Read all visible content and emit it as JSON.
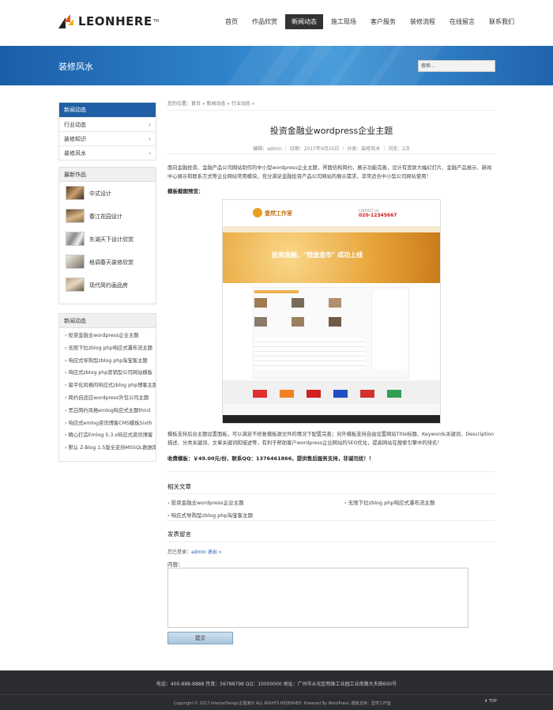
{
  "header": {
    "logo_text": "LEONHERE",
    "logo_tm": "TM",
    "nav": [
      "首页",
      "作品欣赏",
      "新闻动态",
      "施工现场",
      "客户服务",
      "装修流程",
      "在线留言",
      "联系我们"
    ]
  },
  "banner": {
    "title": "装修风水",
    "search_placeholder": "搜索..."
  },
  "sidebar": {
    "cat_title": "新闻动态",
    "categories": [
      "行业动态",
      "装修知识",
      "装修风水"
    ],
    "works_title": "最新作品",
    "works": [
      "中式设计",
      "春江花园设计",
      "东湖天下设计欣赏",
      "格调春天装修欣赏",
      "现代简约画品房"
    ],
    "news_title": "新闻动态",
    "news": [
      "› 投资金融业wordpress企业主题",
      "› 无限下拉zblog php响应式瀑布流主题",
      "› 响应式导购型zblog php淘宝客主题",
      "› 响应式zblog php营销型公司网站模板",
      "› 扁平化风格的响应式zblog php博客主题",
      "› 简约自适应wordpress外包公司主题",
      "› 黑白简约风格emlog响应式主题third",
      "› 响应式emlog资讯博客CMS模板Sixth",
      "› 精心打造Emlog 5.3.x响应式资讯博客",
      "› 默认 Z-Blog 1.5版全支持MSSQL数据库"
    ]
  },
  "article": {
    "breadcrumb": "您的位置：首页 » 新闻动态 » 行业动态 »",
    "title": "投资金融业wordpress企业主题",
    "meta": "编辑：admin ｜ 日期：2017年9月25日 ｜ 分类：装修风水 ｜ 浏览：2次",
    "para1": "面向金融投资、金融产品公司网站制作的中小型wordpress企业主题，界面结构简约，展示功能完善，设计有宽屏大幅幻灯片、金融产品展示、新闻中心展示和联系方式等企业网站常用模块，充分满足金融投资产品公司网站的展示需求，非常适合中小型公司网站使用！",
    "preview_label": "模板截图预览：",
    "para2": "模板支持后台主题设置面板，可以满足不修复模板源文件的情况下配置完善；另外模板支持自由设置网站Title标题、Keywords关键词、Description描述、分类关键词、文章关键词和描述等，有利于帮助客户wordpress企业网站的SEO优化，提高网站在搜索引擎中的排名！",
    "price": "收费模板：￥49.00元/份，联系QQ：1376461866，提供售后服务支持，非诚勿扰！！"
  },
  "screenshot_preview": {
    "brand": "壹然工作室",
    "contact_label": "CONTACT US",
    "phone": "020-12345667",
    "slogan": "投资金融，\"钱途金市\"  成功上线"
  },
  "related": {
    "title": "相关文章",
    "items": [
      "› 投资金融业wordpress企业主题",
      "› 无限下拉zblog php响应式瀑布流主题",
      "› 响应式导购型zblog php淘宝客主题"
    ]
  },
  "comment": {
    "title": "发表留言",
    "login_prefix": "您已登录：",
    "login_user": "admin",
    "logout_link": "退出 »",
    "content_label": "内容：",
    "submit_label": "提交"
  },
  "footer": {
    "contact": "电话：400-888-8888    传真：56788798    QQ：10000000    地址：广州市从化区明珠工业园工业南路大夫田600号",
    "copyright": "Copyright © 2017 InteriorDesign主题演示 ALL RIGHTS RESERVED. Powered By WordPress. 模板支持：壹然工作室",
    "top_label": "TOP"
  },
  "colors": {
    "primary_blue": "#1e5fa5",
    "nav_active": "#333333",
    "footer_bg": "#2c2c33"
  }
}
